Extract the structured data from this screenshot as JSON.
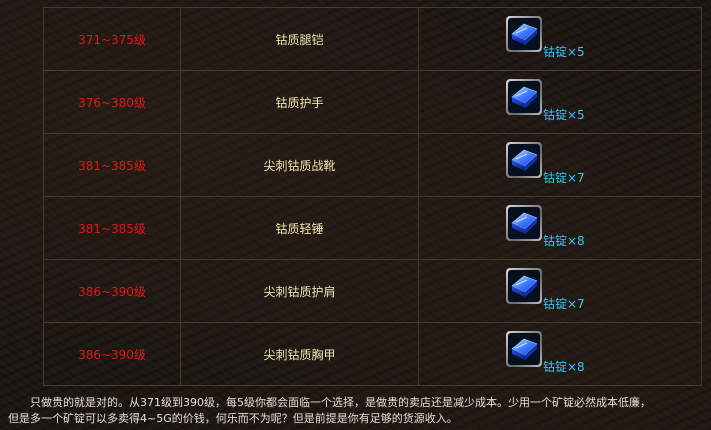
{
  "rows": [
    {
      "level": "371~375级",
      "item": "钴质腿铠",
      "reward": "钴锭×5",
      "reward_icon": "cobalt-ingot-icon"
    },
    {
      "level": "376~380级",
      "item": "钴质护手",
      "reward": "钴锭×5",
      "reward_icon": "cobalt-ingot-icon"
    },
    {
      "level": "381~385级",
      "item": "尖刺钴质战靴",
      "reward": "钴锭×7",
      "reward_icon": "cobalt-ingot-icon"
    },
    {
      "level": "381~385级",
      "item": "钴质轻锤",
      "reward": "钴锭×8",
      "reward_icon": "cobalt-ingot-icon"
    },
    {
      "level": "386~390级",
      "item": "尖刺钴质护肩",
      "reward": "钴锭×7",
      "reward_icon": "cobalt-ingot-icon"
    },
    {
      "level": "386~390级",
      "item": "尖刺钴质胸甲",
      "reward": "钴锭×8",
      "reward_icon": "cobalt-ingot-icon"
    }
  ],
  "note": {
    "line1": "只做贵的就是对的。从371级到390级，每5级你都会面临一个选择，是做贵的卖店还是减少成本。少用一个矿锭必然成本低廉，",
    "line2": "但是多一个矿锭可以多卖得4~5G的价钱，何乐而不为呢？但是前提是你有足够的货源收入。"
  },
  "colors": {
    "level_text": "#e01818",
    "item_text": "#f0e2b0",
    "reward_text": "#3fc3f5",
    "border": "#4a3a28"
  }
}
